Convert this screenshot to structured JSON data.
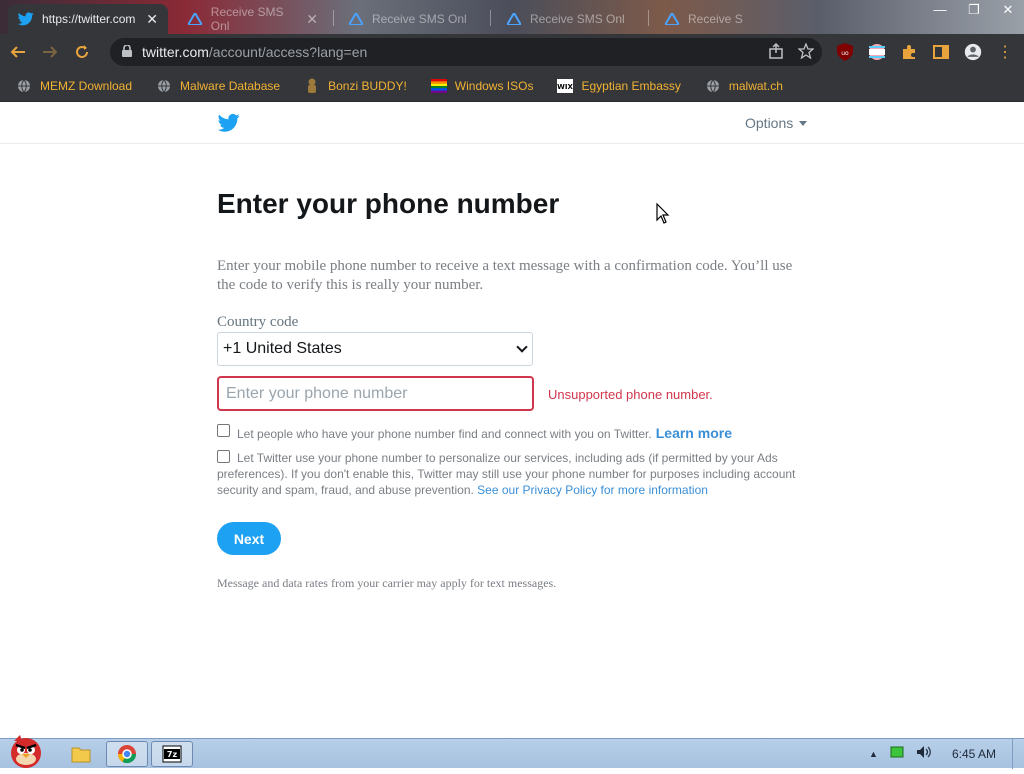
{
  "browser": {
    "tabs": [
      {
        "title": "https://twitter.com",
        "active": true
      },
      {
        "title": "Receive SMS Onl",
        "active": false
      },
      {
        "title": "Receive SMS Onl",
        "active": false
      },
      {
        "title": "Receive SMS Onl",
        "active": false
      },
      {
        "title": "Receive S",
        "active": false
      }
    ],
    "url_host": "twitter.com",
    "url_path": "/account/access?lang=en",
    "bookmarks": [
      {
        "label": "MEMZ Download",
        "icon": "globe-icon"
      },
      {
        "label": "Malware Database",
        "icon": "globe-icon"
      },
      {
        "label": "Bonzi BUDDY!",
        "icon": "bonzi-icon"
      },
      {
        "label": "Windows ISOs",
        "icon": "pride-flag-icon"
      },
      {
        "label": "Egyptian Embassy",
        "icon": "wix-icon"
      },
      {
        "label": "malwat.ch",
        "icon": "globe-icon"
      }
    ]
  },
  "header": {
    "options_label": "Options"
  },
  "form": {
    "title": "Enter your phone number",
    "description": "Enter your mobile phone number to receive a text message with a confirmation code. You’ll use the code to verify this is really your number.",
    "country_label": "Country code",
    "country_value": "+1 United States",
    "phone_value": "",
    "phone_placeholder": "Enter your phone number",
    "error": "Unsupported phone number.",
    "check1_text": "Let people who have your phone number find and connect with you on Twitter.",
    "learn_more": "Learn more",
    "check2_text": "Let Twitter use your phone number to personalize our services, including ads (if permitted by your Ads preferences). If you don't enable this, Twitter may still use your phone number for purposes including account security and spam, fraud, and abuse prevention.",
    "policy_link": "See our Privacy Policy for more information",
    "next_label": "Next",
    "rates_note": "Message and data rates from your carrier may apply for text messages."
  },
  "taskbar": {
    "time": "6:45 AM"
  },
  "colors": {
    "twitter_blue": "#1da1f2",
    "error_red": "#d0364c",
    "link_blue": "#3a8fd6",
    "bookmark_text": "#f2b233"
  }
}
